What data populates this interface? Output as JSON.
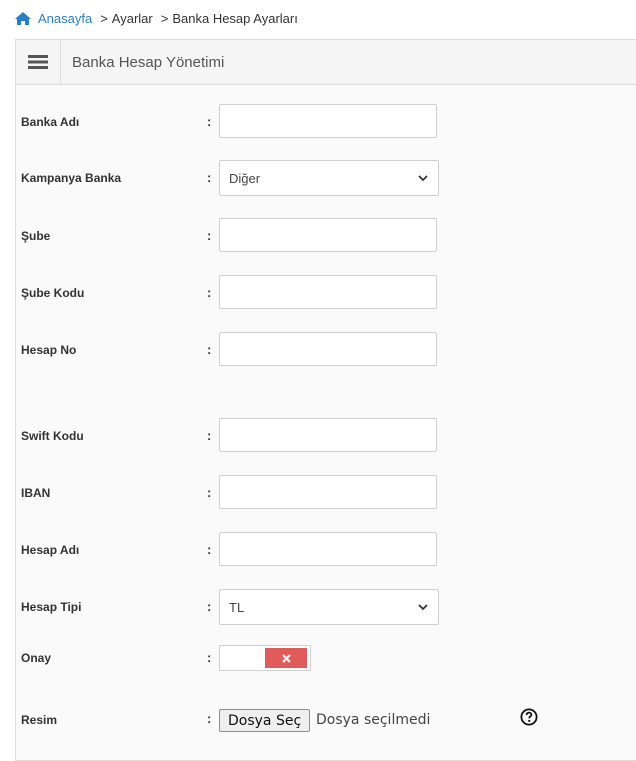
{
  "breadcrumb": {
    "home": "Anasayfa",
    "items": [
      "Ayarlar",
      "Banka Hesap Ayarları"
    ],
    "separator": ">"
  },
  "panel": {
    "title": "Banka Hesap Yönetimi",
    "menu_icon": "hamburger-icon"
  },
  "form": {
    "colon": ":",
    "bank_name": {
      "label": "Banka Adı",
      "value": ""
    },
    "campaign_bank": {
      "label": "Kampanya Banka",
      "value": "Diğer"
    },
    "branch": {
      "label": "Şube",
      "value": ""
    },
    "branch_code": {
      "label": "Şube Kodu",
      "value": ""
    },
    "account_no": {
      "label": "Hesap No",
      "value": ""
    },
    "swift": {
      "label": "Swift Kodu",
      "value": ""
    },
    "iban": {
      "label": "IBAN",
      "value": ""
    },
    "account_name": {
      "label": "Hesap Adı",
      "value": ""
    },
    "account_type": {
      "label": "Hesap Tipi",
      "value": "TL"
    },
    "approval": {
      "label": "Onay",
      "state": "off"
    },
    "image": {
      "label": "Resim",
      "button": "Dosya Seç",
      "status": "Dosya seçilmedi"
    }
  },
  "colors": {
    "link": "#2a7fc3",
    "toggle_off": "#e05b5b"
  }
}
